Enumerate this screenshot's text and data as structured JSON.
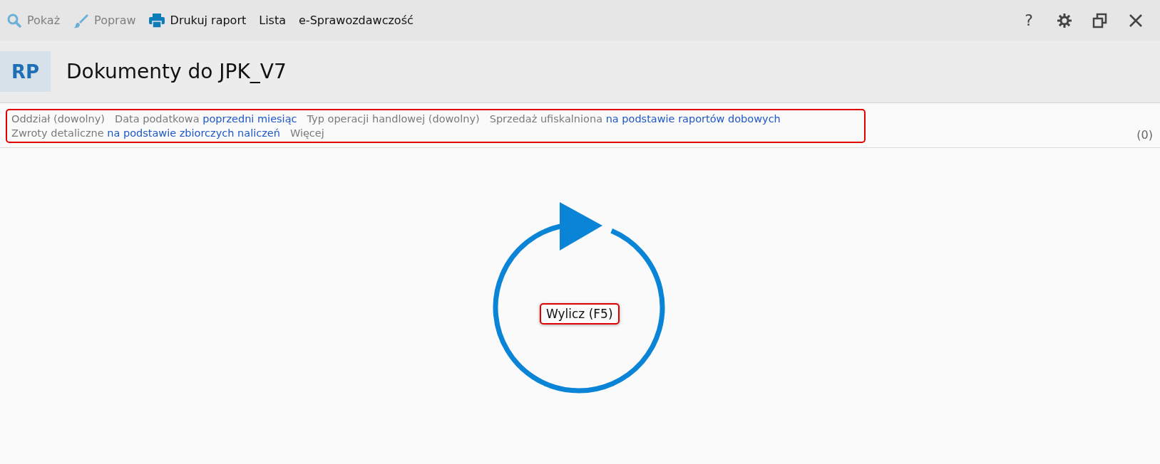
{
  "toolbar": {
    "actions": [
      {
        "label": "Pokaż",
        "kind": "search",
        "disabled": true
      },
      {
        "label": "Popraw",
        "kind": "brush",
        "disabled": true
      },
      {
        "label": "Drukuj raport",
        "kind": "printer",
        "disabled": false
      },
      {
        "label": "Lista",
        "disabled": false
      },
      {
        "label": "e-Sprawozdawczość",
        "disabled": false
      }
    ],
    "window_buttons": [
      {
        "label": "?",
        "kind": "help"
      },
      {
        "kind": "settings"
      },
      {
        "kind": "restore"
      },
      {
        "kind": "close"
      }
    ]
  },
  "header": {
    "badge": "RP",
    "title": "Dokumenty do JPK_V7"
  },
  "filters": {
    "highlighted": true,
    "items": [
      {
        "label": "Oddział (dowolny)"
      },
      {
        "label": "Data podatkowa",
        "value": "poprzedni miesiąc"
      },
      {
        "label": "Typ operacji handlowej (dowolny)"
      },
      {
        "label": "Sprzedaż ufiskalniona",
        "value": "na podstawie raportów dobowych"
      },
      {
        "label": "Zwroty detaliczne",
        "value": "na podstawie zbiorczych naliczeń"
      },
      {
        "label": "Więcej"
      }
    ],
    "count": "(0)"
  },
  "calculate": {
    "label": "Wylicz (F5)",
    "highlighted": true
  }
}
